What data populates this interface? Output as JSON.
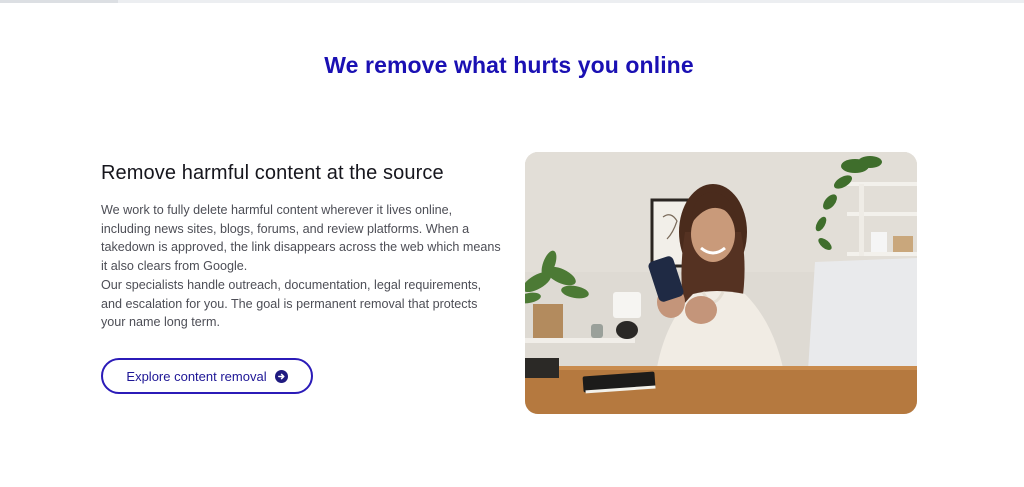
{
  "section": {
    "headline": "We remove what hurts you online"
  },
  "content": {
    "subheading": "Remove harmful content at the source",
    "paragraph_1": "We work to fully delete harmful content wherever it lives online, including news sites, blogs, forums, and review platforms. When a takedown is approved, the link disappears across the web which means it also clears from Google.",
    "paragraph_2": "Our specialists handle outreach, documentation, legal requirements, and escalation for you. The goal is permanent removal that protects your name long term.",
    "cta_label": "Explore content removal",
    "cta_icon": "arrow-right-circle-icon"
  },
  "colors": {
    "headline": "#1a10b3",
    "button_border": "#2b1bb8",
    "body_text": "#4d4e56"
  }
}
